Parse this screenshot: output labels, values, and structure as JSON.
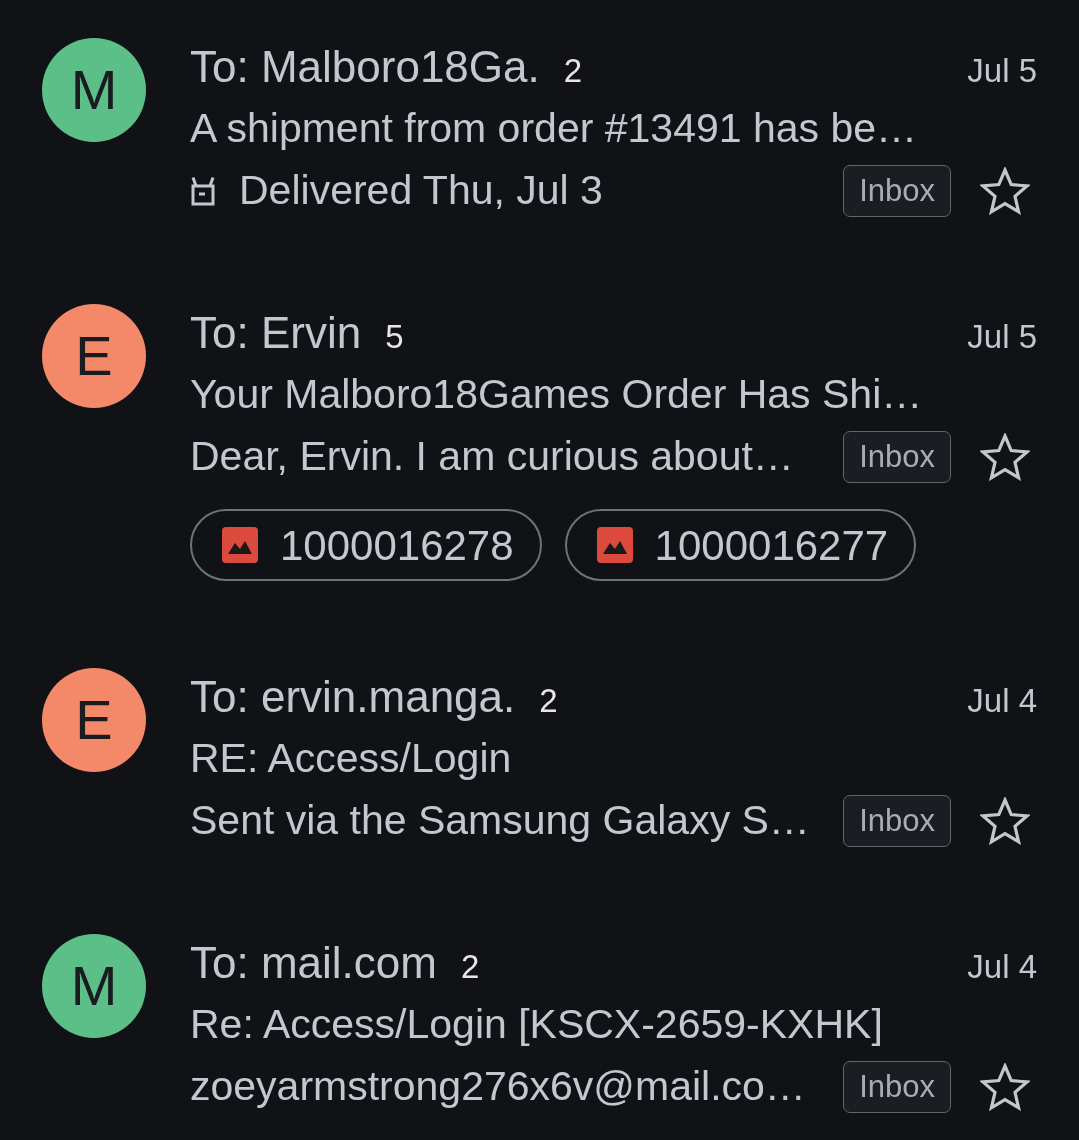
{
  "threads": [
    {
      "avatar": {
        "letter": "M",
        "color": "#5cbf87"
      },
      "sender": "To: Malboro18Ga.",
      "count": "2",
      "date": "Jul 5",
      "subject": "A shipment from order #13491 has be…",
      "snippet": {
        "kind": "delivery",
        "text": "Delivered Thu, Jul 3"
      },
      "label": "Inbox",
      "starred": false
    },
    {
      "avatar": {
        "letter": "E",
        "color": "#f4896a"
      },
      "sender": "To: Ervin",
      "count": "5",
      "date": "Jul 5",
      "subject": "Your Malboro18Games Order Has Shi…",
      "snippet": {
        "kind": "message",
        "text": "Dear, Ervin. I am curious about…"
      },
      "label": "Inbox",
      "starred": false,
      "attachments": [
        {
          "kind": "image",
          "name": "1000016278"
        },
        {
          "kind": "image",
          "name": "1000016277"
        }
      ]
    },
    {
      "avatar": {
        "letter": "E",
        "color": "#f4896a"
      },
      "sender": "To: ervin.manga.",
      "count": "2",
      "date": "Jul 4",
      "subject": "RE: Access/Login",
      "snippet": {
        "kind": "message",
        "text": "Sent via the Samsung Galaxy S…"
      },
      "label": "Inbox",
      "starred": false
    },
    {
      "avatar": {
        "letter": "M",
        "color": "#5cbf87"
      },
      "sender": "To: mail.com",
      "count": "2",
      "date": "Jul 4",
      "subject": "Re: Access/Login [KSCX-2659-KXHK]",
      "snippet": {
        "kind": "message",
        "text": "zoeyarmstrong276x6v@mail.co…"
      },
      "label": "Inbox",
      "starred": false
    }
  ]
}
